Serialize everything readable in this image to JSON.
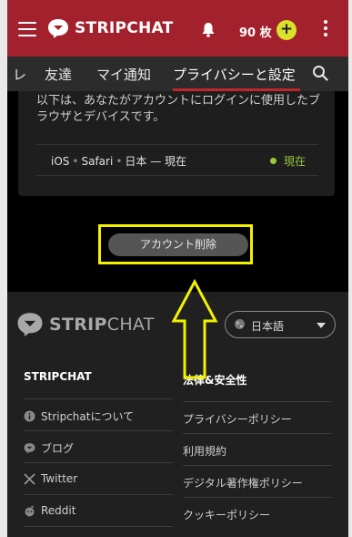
{
  "header": {
    "brand": "STRIPCHAT",
    "tokens": "90 枚",
    "plus": "+"
  },
  "tabs": [
    {
      "label": "レ"
    },
    {
      "label": "友達"
    },
    {
      "label": "マイ通知"
    },
    {
      "label": "プライバシーと設定"
    }
  ],
  "content": {
    "description": "以下は、あなたがアカウントにログインに使用したブラウザとデバイスです。",
    "session": {
      "os": "iOS",
      "browser": "Safari",
      "location": "日本 — 現在",
      "status": "現在",
      "status_color": "#9bc93a"
    },
    "delete_button": "アカウント削除"
  },
  "footer": {
    "brand_bold": "STRIP",
    "brand_thin": "CHAT",
    "language": "日本語",
    "col1_title": "STRIPCHAT",
    "col1_items": [
      {
        "label": "Stripchatについて",
        "icon": "info-icon"
      },
      {
        "label": "ブログ",
        "icon": "chat-bubble-icon"
      },
      {
        "label": "Twitter",
        "icon": "x-logo-icon"
      },
      {
        "label": "Reddit",
        "icon": "reddit-icon"
      }
    ],
    "col2_title": "法律&安全性",
    "col2_items": [
      {
        "label": "プライバシーポリシー"
      },
      {
        "label": "利用規約"
      },
      {
        "label": "デジタル著作権ポリシー"
      },
      {
        "label": "クッキーポリシー"
      }
    ]
  },
  "colors": {
    "header_bg": "#a3212d",
    "accent_plus": "#d8e22a",
    "highlight": "#f2f200"
  }
}
